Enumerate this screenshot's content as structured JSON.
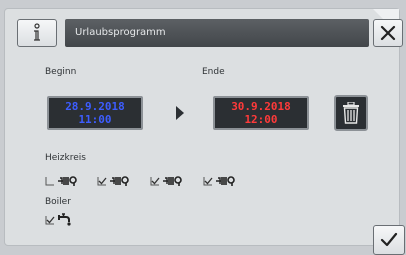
{
  "header": {
    "title": "Urlaubsprogramm",
    "info_icon": "info-icon",
    "close_icon": "close-icon"
  },
  "schedule": {
    "begin_label": "Beginn",
    "end_label": "Ende",
    "begin_date": "28.9.2018",
    "begin_time": "11:00",
    "end_date": "30.9.2018",
    "end_time": "12:00",
    "arrow_icon": "play-arrow-icon",
    "delete_icon": "trash-icon"
  },
  "heating": {
    "label": "Heizkreis",
    "circuits": [
      {
        "checked": false
      },
      {
        "checked": true
      },
      {
        "checked": true
      },
      {
        "checked": true
      }
    ]
  },
  "boiler": {
    "label": "Boiler",
    "checked": true
  },
  "footer": {
    "confirm_icon": "checkmark-icon"
  },
  "colors": {
    "begin_text": "#3d5dff",
    "end_text": "#ff3a3a",
    "title_bar": "#4a4e52",
    "background": "#dcdfe1"
  }
}
